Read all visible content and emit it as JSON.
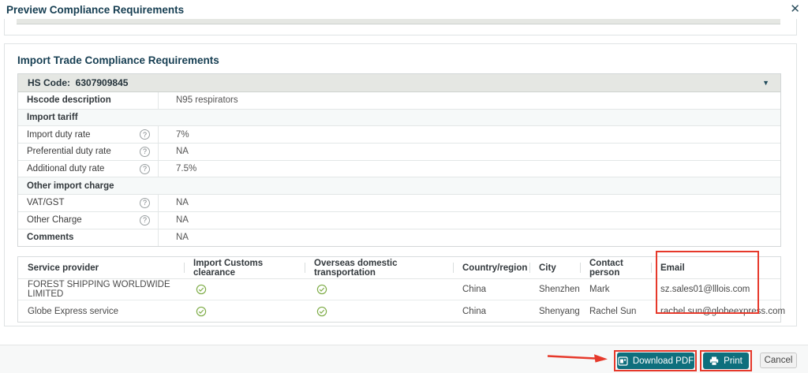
{
  "dialog": {
    "title": "Preview Compliance Requirements",
    "close_label": "✕"
  },
  "content": {
    "section_heading": "Import Trade Compliance Requirements",
    "hs_header": {
      "label": "HS Code:",
      "value": "6307909845"
    },
    "hs_rows": [
      {
        "type": "field",
        "label": "Hscode description",
        "bold": true,
        "help": false,
        "value": "N95 respirators"
      },
      {
        "type": "section",
        "label": "Import tariff"
      },
      {
        "type": "field",
        "label": "Import duty rate",
        "bold": false,
        "help": true,
        "value": "7%"
      },
      {
        "type": "field",
        "label": "Preferential duty rate",
        "bold": false,
        "help": true,
        "value": "NA"
      },
      {
        "type": "field",
        "label": "Additional duty rate",
        "bold": false,
        "help": true,
        "value": "7.5%"
      },
      {
        "type": "section",
        "label": "Other import charge"
      },
      {
        "type": "field",
        "label": "VAT/GST",
        "bold": false,
        "help": true,
        "value": "NA"
      },
      {
        "type": "field",
        "label": "Other Charge",
        "bold": false,
        "help": true,
        "value": "NA"
      },
      {
        "type": "field",
        "label": "Comments",
        "bold": true,
        "help": false,
        "value": "NA"
      }
    ],
    "providers": {
      "columns": [
        "Service provider",
        "Import Customs clearance",
        "Overseas domestic transportation",
        "Country/region",
        "City",
        "Contact person",
        "Email"
      ],
      "rows": [
        {
          "service_provider": "FOREST SHIPPING WORLDWIDE LIMITED",
          "import_customs_clearance": true,
          "overseas_domestic_transportation": true,
          "country": "China",
          "city": "Shenzhen",
          "contact": "Mark",
          "email": "sz.sales01@lllois.com"
        },
        {
          "service_provider": "Globe Express service",
          "import_customs_clearance": true,
          "overseas_domestic_transportation": true,
          "country": "China",
          "city": "Shenyang",
          "contact": "Rachel Sun",
          "email": "rachel.sun@globeexpress.com"
        }
      ]
    }
  },
  "footer": {
    "download_pdf": "Download PDF",
    "print": "Print",
    "cancel": "Cancel"
  },
  "colors": {
    "accent_teal": "#0e6f7d",
    "annotation_red": "#e6392b",
    "check_green": "#7cab44",
    "title_navy": "#163e52"
  }
}
